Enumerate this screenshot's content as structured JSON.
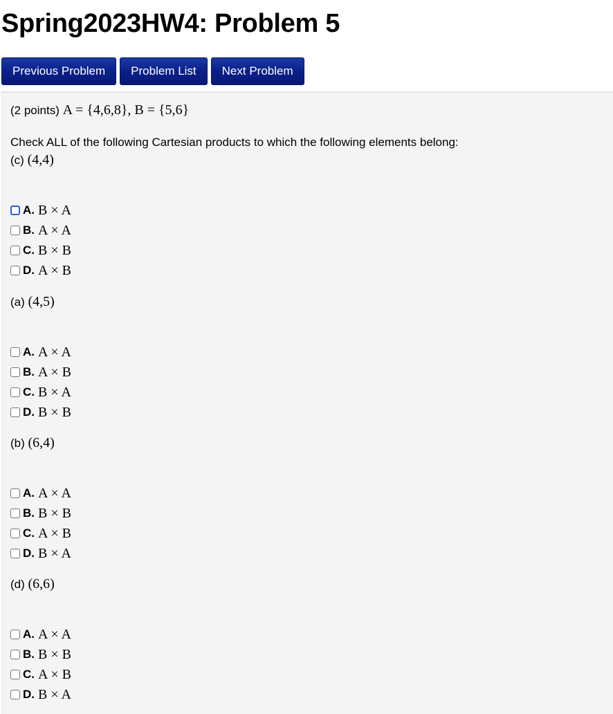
{
  "page_title": "Spring2023HW4: Problem 5",
  "nav": {
    "previous": "Previous Problem",
    "list": "Problem List",
    "next": "Next Problem"
  },
  "problem": {
    "points": "(2 points)",
    "sets": "A = {4,6,8}, B = {5,6}",
    "instruction": "Check ALL of the following Cartesian products to which the following elements belong:",
    "parts": [
      {
        "label": "(c)",
        "element": "(4,4)",
        "options": [
          {
            "letter": "A.",
            "text": "B × A",
            "checked": false,
            "focused": true
          },
          {
            "letter": "B.",
            "text": "A × A",
            "checked": false
          },
          {
            "letter": "C.",
            "text": "B × B",
            "checked": false
          },
          {
            "letter": "D.",
            "text": "A × B",
            "checked": false
          }
        ]
      },
      {
        "label": "(a)",
        "element": "(4,5)",
        "options": [
          {
            "letter": "A.",
            "text": "A × A",
            "checked": false
          },
          {
            "letter": "B.",
            "text": "A × B",
            "checked": false
          },
          {
            "letter": "C.",
            "text": "B × A",
            "checked": false
          },
          {
            "letter": "D.",
            "text": "B × B",
            "checked": false
          }
        ]
      },
      {
        "label": "(b)",
        "element": "(6,4)",
        "options": [
          {
            "letter": "A.",
            "text": "A × A",
            "checked": false
          },
          {
            "letter": "B.",
            "text": "B × B",
            "checked": false
          },
          {
            "letter": "C.",
            "text": "A × B",
            "checked": false
          },
          {
            "letter": "D.",
            "text": "B × A",
            "checked": false
          }
        ]
      },
      {
        "label": "(d)",
        "element": "(6,6)",
        "options": [
          {
            "letter": "A.",
            "text": "A × A",
            "checked": false
          },
          {
            "letter": "B.",
            "text": "B × B",
            "checked": false
          },
          {
            "letter": "C.",
            "text": "A × B",
            "checked": false
          },
          {
            "letter": "D.",
            "text": "B × A",
            "checked": false
          }
        ]
      }
    ]
  }
}
